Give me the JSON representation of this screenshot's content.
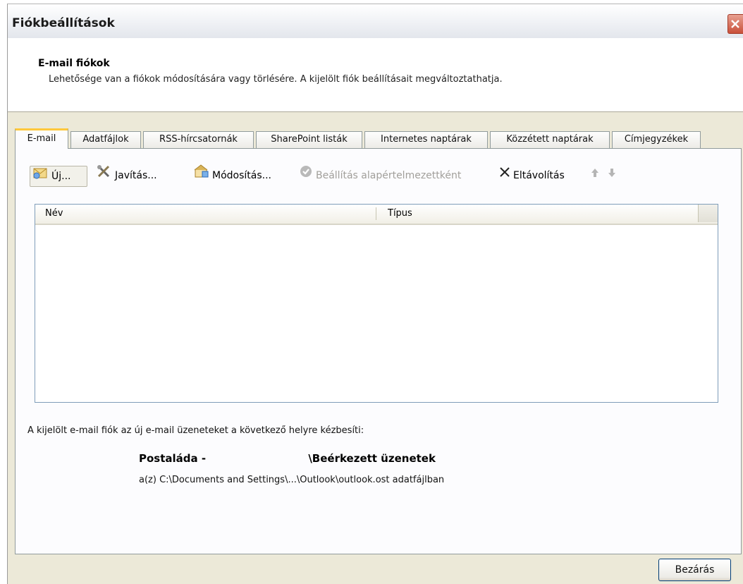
{
  "window": {
    "title": "Fiókbeállítások"
  },
  "header": {
    "title": "E-mail fiókok",
    "description": "Lehetősége van a fiókok módosítására vagy törlésére. A kijelölt fiók beállításait megváltoztathatja."
  },
  "tabs": [
    {
      "label": "E-mail",
      "active": true
    },
    {
      "label": "Adatfájlok"
    },
    {
      "label": "RSS-hírcsatornák"
    },
    {
      "label": "SharePoint listák"
    },
    {
      "label": "Internetes naptárak"
    },
    {
      "label": "Közzétett naptárak"
    },
    {
      "label": "Címjegyzékek"
    }
  ],
  "toolbar": {
    "new_label": "Új...",
    "repair_label": "Javítás...",
    "change_label": "Módosítás...",
    "set_default_label": "Beállítás alapértelmezettként",
    "remove_label": "Eltávolítás"
  },
  "list": {
    "columns": [
      "Név",
      "Típus"
    ],
    "rows": []
  },
  "delivery": {
    "text": "A kijelölt e-mail fiók az új e-mail üzeneteket a következő helyre kézbesíti:",
    "mailbox_prefix": "Postaláda - ",
    "mailbox_folder": "\\Beérkezett üzenetek",
    "datafile": "a(z) C:\\Documents and Settings\\...\\Outlook\\outlook.ost adatfájlban"
  },
  "footer": {
    "close_label": "Bezárás"
  },
  "icons": {
    "close": "close-icon",
    "new": "new-mail-icon",
    "repair": "tools-icon",
    "change": "change-icon",
    "default": "checkmark-icon",
    "remove": "x-icon",
    "up": "arrow-up-icon",
    "down": "arrow-down-icon"
  },
  "colors": {
    "active_tab_accent": "#ffc83c",
    "close_button": "#c9503a",
    "dialog_bg": "#ece9d8"
  }
}
